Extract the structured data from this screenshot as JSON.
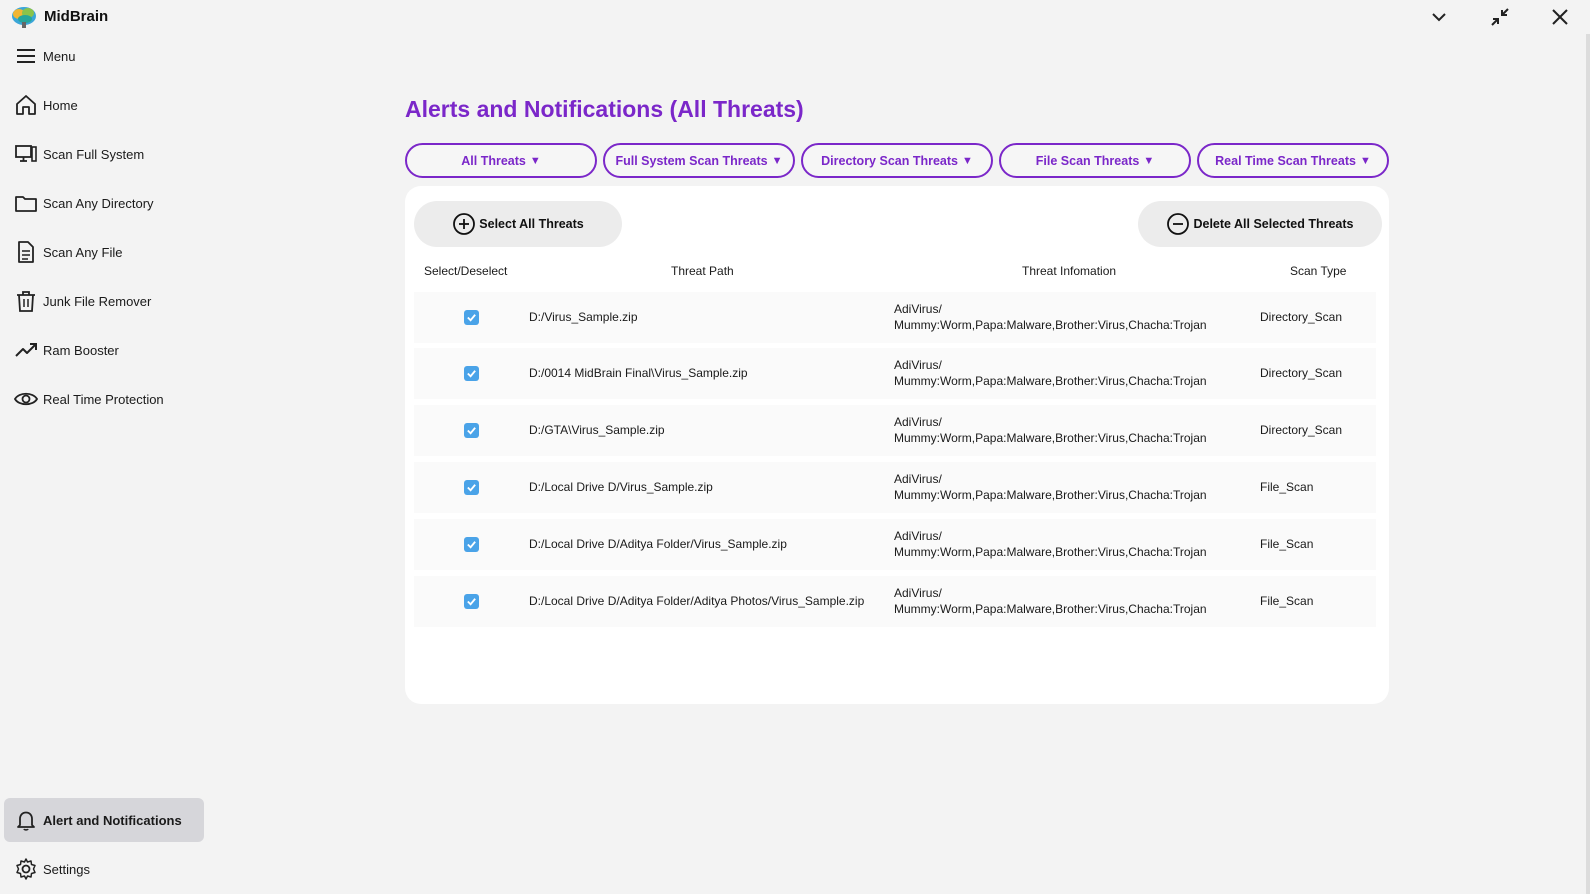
{
  "app": {
    "title": "MidBrain"
  },
  "window_controls": {
    "collapse_icon": "chevron-down-icon",
    "restore_icon": "minimize-arrows-icon",
    "close_icon": "close-icon"
  },
  "sidebar": {
    "menu_label": "Menu",
    "items": [
      {
        "label": "Home",
        "icon": "home-icon"
      },
      {
        "label": "Scan Full System",
        "icon": "monitor-icon"
      },
      {
        "label": "Scan Any Directory",
        "icon": "folder-icon"
      },
      {
        "label": "Scan Any File",
        "icon": "file-icon"
      },
      {
        "label": "Junk File Remover",
        "icon": "trash-icon"
      },
      {
        "label": "Ram Booster",
        "icon": "trend-up-icon"
      },
      {
        "label": "Real Time Protection",
        "icon": "eye-icon"
      }
    ],
    "bottom_items": [
      {
        "label": "Alert and Notifications",
        "icon": "bell-icon",
        "active": true
      },
      {
        "label": "Settings",
        "icon": "gear-icon"
      }
    ]
  },
  "main": {
    "title": "Alerts and Notifications (All Threats)",
    "accent_color": "#7b27c9",
    "filters": [
      {
        "label": "All Threats"
      },
      {
        "label": "Full System Scan Threats"
      },
      {
        "label": "Directory Scan Threats"
      },
      {
        "label": "File Scan Threats"
      },
      {
        "label": "Real Time Scan Threats"
      }
    ],
    "filter_caret": "▼",
    "select_all_label": "Select All Threats",
    "delete_selected_label": "Delete All Selected Threats",
    "columns": [
      "Select/Deselect",
      "Threat Path",
      "Threat Infomation",
      "Scan Type"
    ],
    "rows": [
      {
        "checked": true,
        "path": "D:/Virus_Sample.zip",
        "info_line1": "AdiVirus/",
        "info_line2": "Mummy:Worm,Papa:Malware,Brother:Virus,Chacha:Trojan",
        "scan_type": "Directory_Scan"
      },
      {
        "checked": true,
        "path": "D:/0014 MidBrain Final\\Virus_Sample.zip",
        "info_line1": "AdiVirus/",
        "info_line2": "Mummy:Worm,Papa:Malware,Brother:Virus,Chacha:Trojan",
        "scan_type": "Directory_Scan"
      },
      {
        "checked": true,
        "path": "D:/GTA\\Virus_Sample.zip",
        "info_line1": "AdiVirus/",
        "info_line2": "Mummy:Worm,Papa:Malware,Brother:Virus,Chacha:Trojan",
        "scan_type": "Directory_Scan"
      },
      {
        "checked": true,
        "path": "D:/Local Drive D/Virus_Sample.zip",
        "info_line1": "AdiVirus/",
        "info_line2": "Mummy:Worm,Papa:Malware,Brother:Virus,Chacha:Trojan",
        "scan_type": "File_Scan"
      },
      {
        "checked": true,
        "path": "D:/Local Drive D/Aditya Folder/Virus_Sample.zip",
        "info_line1": "AdiVirus/",
        "info_line2": "Mummy:Worm,Papa:Malware,Brother:Virus,Chacha:Trojan",
        "scan_type": "File_Scan"
      },
      {
        "checked": true,
        "path": "D:/Local Drive D/Aditya Folder/Aditya Photos/Virus_Sample.zip",
        "info_line1": "AdiVirus/",
        "info_line2": "Mummy:Worm,Papa:Malware,Brother:Virus,Chacha:Trojan",
        "scan_type": "File_Scan"
      }
    ]
  }
}
